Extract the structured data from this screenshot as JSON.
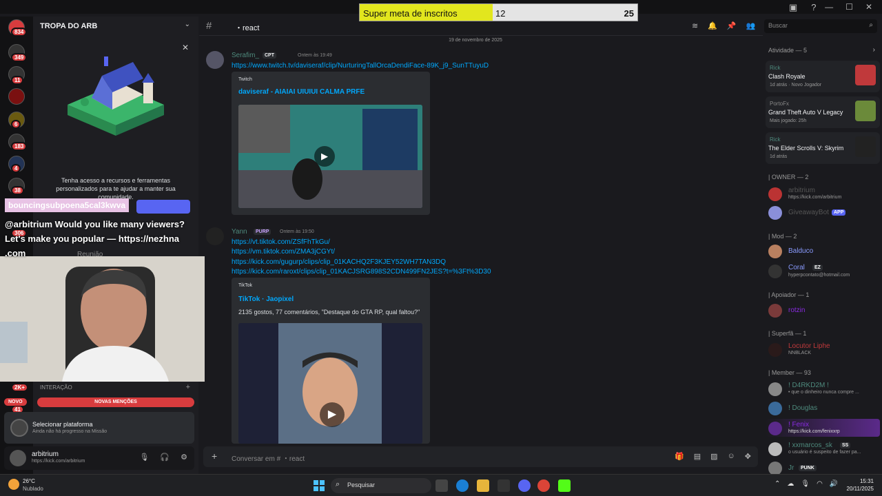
{
  "goal": {
    "label": "Super meta de inscritos",
    "current": "12",
    "target": "25",
    "progress": 0.48
  },
  "server": {
    "name": "TROPA DO ARB"
  },
  "servers": {
    "badges": [
      "834",
      "349",
      "11",
      "6",
      "183",
      "4",
      "38",
      "306",
      "2K+",
      "41"
    ]
  },
  "promo": {
    "text": "Tenha acesso a recursos e ferramentas personalizados para te ajudar a manter sua comunidade."
  },
  "overlay": {
    "alert_name": "bouncingsubpoena5cal3kwva",
    "alert_msg": "@arbitrium Would you like many viewers? Let's make you popular — https://nezhna .com",
    "reuniao": "Reunião"
  },
  "sidebar": {
    "interacao": "INTERAÇÃO",
    "novo": "NOVO",
    "novas": "NOVAS MENÇÕES"
  },
  "quest": {
    "title": "Selecionar plataforma",
    "sub": "Ainda não há progresso na Missão"
  },
  "user": {
    "name": "arbitrium",
    "status": "https://kick.com/arbitrium"
  },
  "channel": {
    "name": "・react"
  },
  "search": {
    "placeholder": "Buscar"
  },
  "chat": {
    "date": "19 de novembro de 2025",
    "m1": {
      "author": "Serafim_",
      "tag": "CPT",
      "time": "Ontem às 19:49",
      "link": "https://www.twitch.tv/daviseraf/clip/NurturingTallOrcaDendiFace-89K_j9_SunTTuyuD",
      "provider": "Twitch",
      "title": "daviseraf - AIAIAI UIUIUI CALMA PRFE"
    },
    "m2": {
      "author": "Yann",
      "tag": "PURP",
      "time": "Ontem às 19:50",
      "links": [
        "https://vt.tiktok.com/ZSfFhTkGu/",
        "https://vm.tiktok.com/ZMA3jCGYt/",
        "https://kick.com/gugurp/clips/clip_01KACHQ2F3KJEY52WH7TAN3DQ",
        "https://kick.com/raroxt/clips/clip_01KACJSRG898S2CDN499FN2JES?t=%3Ft%3D30"
      ],
      "provider": "TikTok",
      "title": "TikTok · Jaopixel",
      "desc": "2135 gostos, 77 comentários, \"Destaque do GTA RP, qual faltou?\""
    }
  },
  "composer": {
    "placeholder": "Conversar em #  ・react"
  },
  "members": {
    "activity_header": "Atividade — 5",
    "activities": [
      {
        "user": "Rick",
        "game": "Clash Royale",
        "sub": "1d atrás · Novo Jogador"
      },
      {
        "user": "PortoFx",
        "game": "Grand Theft Auto V Legacy",
        "sub": "Mais jogado: 25h"
      },
      {
        "user": "Rick",
        "game": "The Elder Scrolls V: Skyrim",
        "sub": "1d atrás"
      }
    ],
    "owner_hdr": "| OWNER — 2",
    "owner": [
      {
        "name": "arbitrium",
        "sub": "https://kick.com/arbitrium"
      },
      {
        "name": "GiveawayBot",
        "tag": "APP"
      }
    ],
    "mod_hdr": "| Mod — 2",
    "mod": [
      {
        "name": "Balduco"
      },
      {
        "name": "Coral",
        "tag": "EZ",
        "sub": "hyperpcontato@hotmail.com"
      }
    ],
    "apoiador_hdr": "| Apoiador — 1",
    "apoiador": [
      {
        "name": "rotzin"
      }
    ],
    "superfa_hdr": "| Superfã — 1",
    "superfa": [
      {
        "name": "Locutor Liphe",
        "sub": "NNBLACK"
      }
    ],
    "member_hdr": "| Member — 93",
    "member": [
      {
        "name": "! D4RKD2M !",
        "sub": "• que o dinheiro nunca compre ..."
      },
      {
        "name": "! Douglas"
      },
      {
        "name": "! Fenix",
        "sub": "https://kick.com/fenixxrp"
      },
      {
        "name": "! xxmarcos_sk",
        "tag": "SS",
        "sub": "o usuário é suspeito de fazer pa..."
      },
      {
        "name": "Jr",
        "tag": "PUNK"
      }
    ]
  },
  "taskbar": {
    "temp": "26°C",
    "weather": "Nublado",
    "search": "Pesquisar",
    "time": "15:31",
    "date": "20/11/2025"
  }
}
